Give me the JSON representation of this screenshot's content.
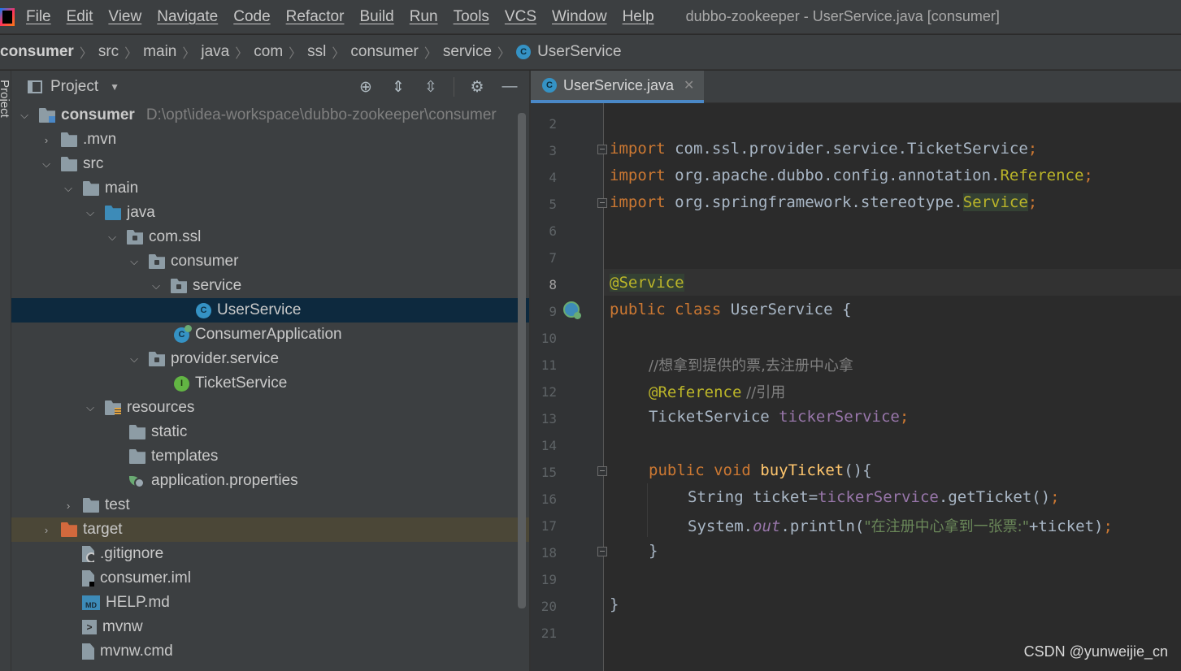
{
  "menubar": {
    "items": [
      "File",
      "Edit",
      "View",
      "Navigate",
      "Code",
      "Refactor",
      "Build",
      "Run",
      "Tools",
      "VCS",
      "Window",
      "Help"
    ],
    "window_title": "dubbo-zookeeper - UserService.java [consumer]"
  },
  "breadcrumb": [
    "consumer",
    "src",
    "main",
    "java",
    "com",
    "ssl",
    "consumer",
    "service",
    "UserService"
  ],
  "tool_stripe": {
    "label": "Project"
  },
  "project_panel": {
    "title": "Project",
    "tree": [
      {
        "label": "consumer",
        "path": "D:\\opt\\idea-workspace\\dubbo-zookeeper\\consumer"
      },
      {
        "label": ".mvn"
      },
      {
        "label": "src"
      },
      {
        "label": "main"
      },
      {
        "label": "java"
      },
      {
        "label": "com.ssl"
      },
      {
        "label": "consumer"
      },
      {
        "label": "service"
      },
      {
        "label": "UserService"
      },
      {
        "label": "ConsumerApplication"
      },
      {
        "label": "provider.service"
      },
      {
        "label": "TicketService"
      },
      {
        "label": "resources"
      },
      {
        "label": "static"
      },
      {
        "label": "templates"
      },
      {
        "label": "application.properties"
      },
      {
        "label": "test"
      },
      {
        "label": "target"
      },
      {
        "label": ".gitignore"
      },
      {
        "label": "consumer.iml"
      },
      {
        "label": "HELP.md"
      },
      {
        "label": "mvnw"
      },
      {
        "label": "mvnw.cmd"
      }
    ]
  },
  "editor": {
    "tab_label": "UserService.java",
    "line_numbers": [
      "2",
      "3",
      "4",
      "5",
      "6",
      "7",
      "8",
      "9",
      "10",
      "11",
      "12",
      "13",
      "14",
      "15",
      "16",
      "17",
      "18",
      "19",
      "20",
      "21"
    ],
    "code": {
      "import_kw": "import",
      "l3_pkg": " com.ssl.provider.service.TicketService",
      "l4_pkg": " org.apache.dubbo.config.annotation.",
      "l4_cls": "Reference",
      "l5_pkg": " org.springframework.stereotype.",
      "l5_cls": "Service",
      "semi": ";",
      "l8_ann": "@Service",
      "l9_kw": "public class",
      "l9_rest": " UserService {",
      "l11_cmt": "//想拿到提供的票,去注册中心拿",
      "l12_ann": "@Reference",
      "l12_cmt": " //引用",
      "l13_type": "TicketService ",
      "l13_field": "tickerService",
      "l15_kw": "public void",
      "l15_meth": " buyTicket",
      "l15_rest": "(){",
      "l16_a": "String ticket=",
      "l16_field": "tickerService",
      "l16_b": ".getTicket()",
      "l17_a": "System.",
      "l17_out": "out",
      "l17_b": ".println(",
      "l17_str": "\"在注册中心拿到一张票:\"",
      "l17_c": "+ticket)",
      "l18": "}",
      "l20": "}"
    }
  },
  "watermark": "CSDN @yunweijie_cn"
}
